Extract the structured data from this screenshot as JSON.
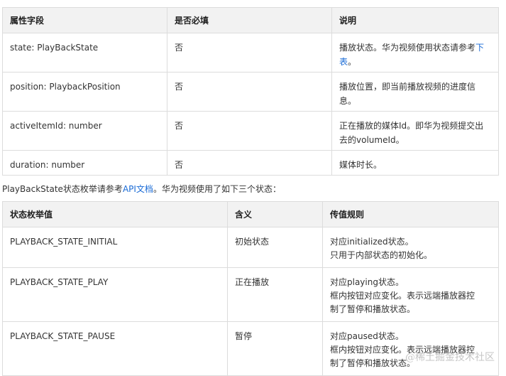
{
  "table1": {
    "headers": [
      "属性字段",
      "是否必填",
      "说明"
    ],
    "rows": [
      {
        "field": "state: PlayBackState",
        "required": "否",
        "desc_text": "播放状态。华为视频使用状态请参考",
        "desc_link": "下表",
        "desc_tail": "。"
      },
      {
        "field": "position: PlaybackPosition",
        "required": "否",
        "desc_text": "播放位置，即当前播放视频的进度信息。"
      },
      {
        "field": "activeItemId: number",
        "required": "否",
        "desc_text": "正在播放的媒体Id。即华为视频提交出去的volumeId。"
      },
      {
        "field": "duration: number",
        "required": "否",
        "desc_text": "媒体时长。"
      }
    ]
  },
  "intro": {
    "before": "PlayBackState状态枚举请参考",
    "link": "API文档",
    "after": "。华为视频使用了如下三个状态："
  },
  "table2": {
    "headers": [
      "状态枚举值",
      "含义",
      "传值规则"
    ],
    "rows": [
      {
        "value": "PLAYBACK_STATE_INITIAL",
        "meaning": "初始状态",
        "rules": [
          "对应initialized状态。",
          "只用于内部状态的初始化。"
        ]
      },
      {
        "value": "PLAYBACK_STATE_PLAY",
        "meaning": "正在播放",
        "rules": [
          "对应playing状态。",
          "框内按钮对应变化。表示远端播放器控",
          "制了暂停和播放状态。"
        ]
      },
      {
        "value": "PLAYBACK_STATE_PAUSE",
        "meaning": "暂停",
        "rules": [
          "对应paused状态。",
          "框内按钮对应变化。表示远端播放器控",
          "制了暂停和播放状态。"
        ]
      }
    ]
  },
  "watermark": "@稀土掘金技术社区",
  "colors": {
    "link": "#1a6bd6",
    "header_bg": "#f2f2f2",
    "border": "#dcdcdc"
  }
}
